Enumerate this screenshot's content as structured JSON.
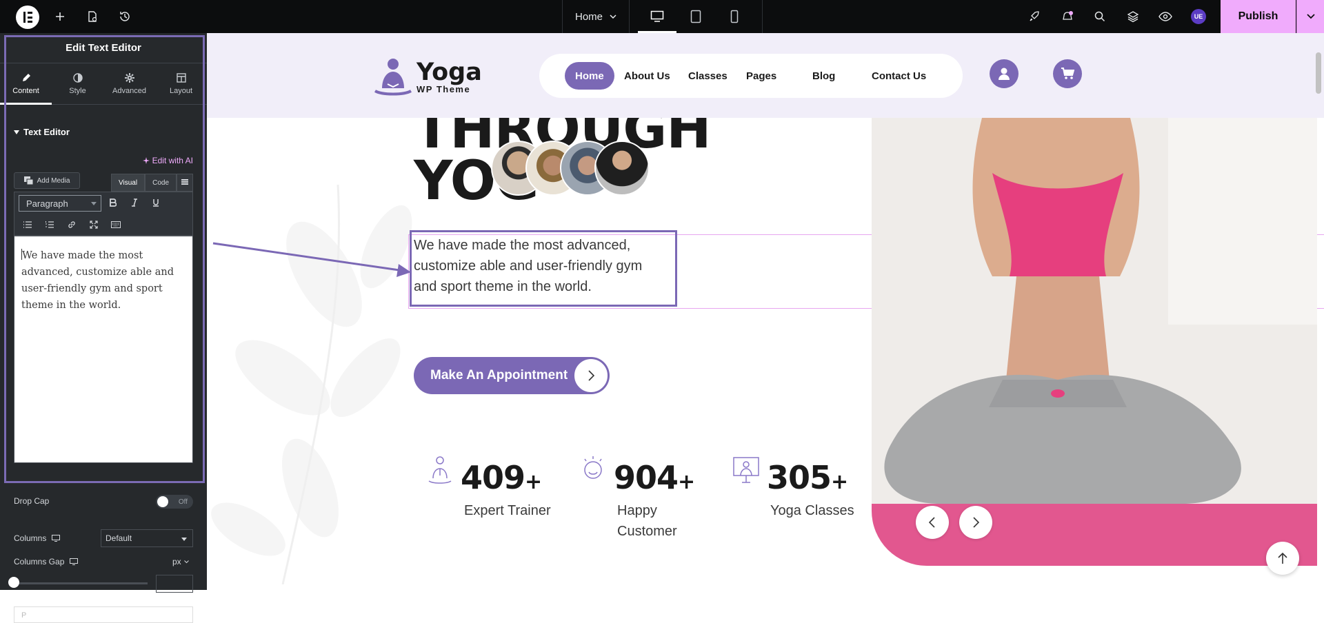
{
  "topbar": {
    "page_name": "Home",
    "publish_label": "Publish",
    "user_initials": "UE"
  },
  "panel": {
    "title": "Edit Text Editor",
    "tabs": [
      {
        "label": "Content",
        "icon": "pencil-icon"
      },
      {
        "label": "Style",
        "icon": "contrast-icon"
      },
      {
        "label": "Advanced",
        "icon": "gear-icon"
      },
      {
        "label": "Layout",
        "icon": "layout-icon"
      }
    ],
    "section_title": "Text Editor",
    "edit_ai_label": "Edit with AI",
    "add_media_label": "Add Media",
    "editor_tabs": {
      "visual": "Visual",
      "code": "Code"
    },
    "format_select": "Paragraph",
    "content_text": "We have made the most advanced, customize able and user-friendly gym and sport theme in the world.",
    "status_path": "P",
    "drop_cap_label": "Drop Cap",
    "drop_cap_state": "Off",
    "columns_label": "Columns",
    "columns_value": "Default",
    "columns_gap_label": "Columns Gap",
    "columns_gap_unit": "px"
  },
  "site": {
    "logo_title": "Yoga",
    "logo_subtitle": "WP Theme",
    "nav": [
      "Home",
      "About Us",
      "Classes",
      "Pages",
      "Blog",
      "Contact Us"
    ],
    "hero_line1": "THROUGH",
    "hero_line2": "YOG",
    "hero_description": "We have made the most advanced, customize able and user-friendly gym and sport theme in the world.",
    "cta_label": "Make An Appointment",
    "stats": [
      {
        "number": "409",
        "suffix": "+",
        "label": "Expert Trainer"
      },
      {
        "number": "904",
        "suffix": "+",
        "label": "Happy Customer"
      },
      {
        "number": "305",
        "suffix": "+",
        "label": "Yoga Classes"
      }
    ]
  },
  "colors": {
    "accent": "#7b68b5",
    "publish": "#f0abfc",
    "panel_bg": "#26292c",
    "header_bg": "#f1eef9"
  }
}
